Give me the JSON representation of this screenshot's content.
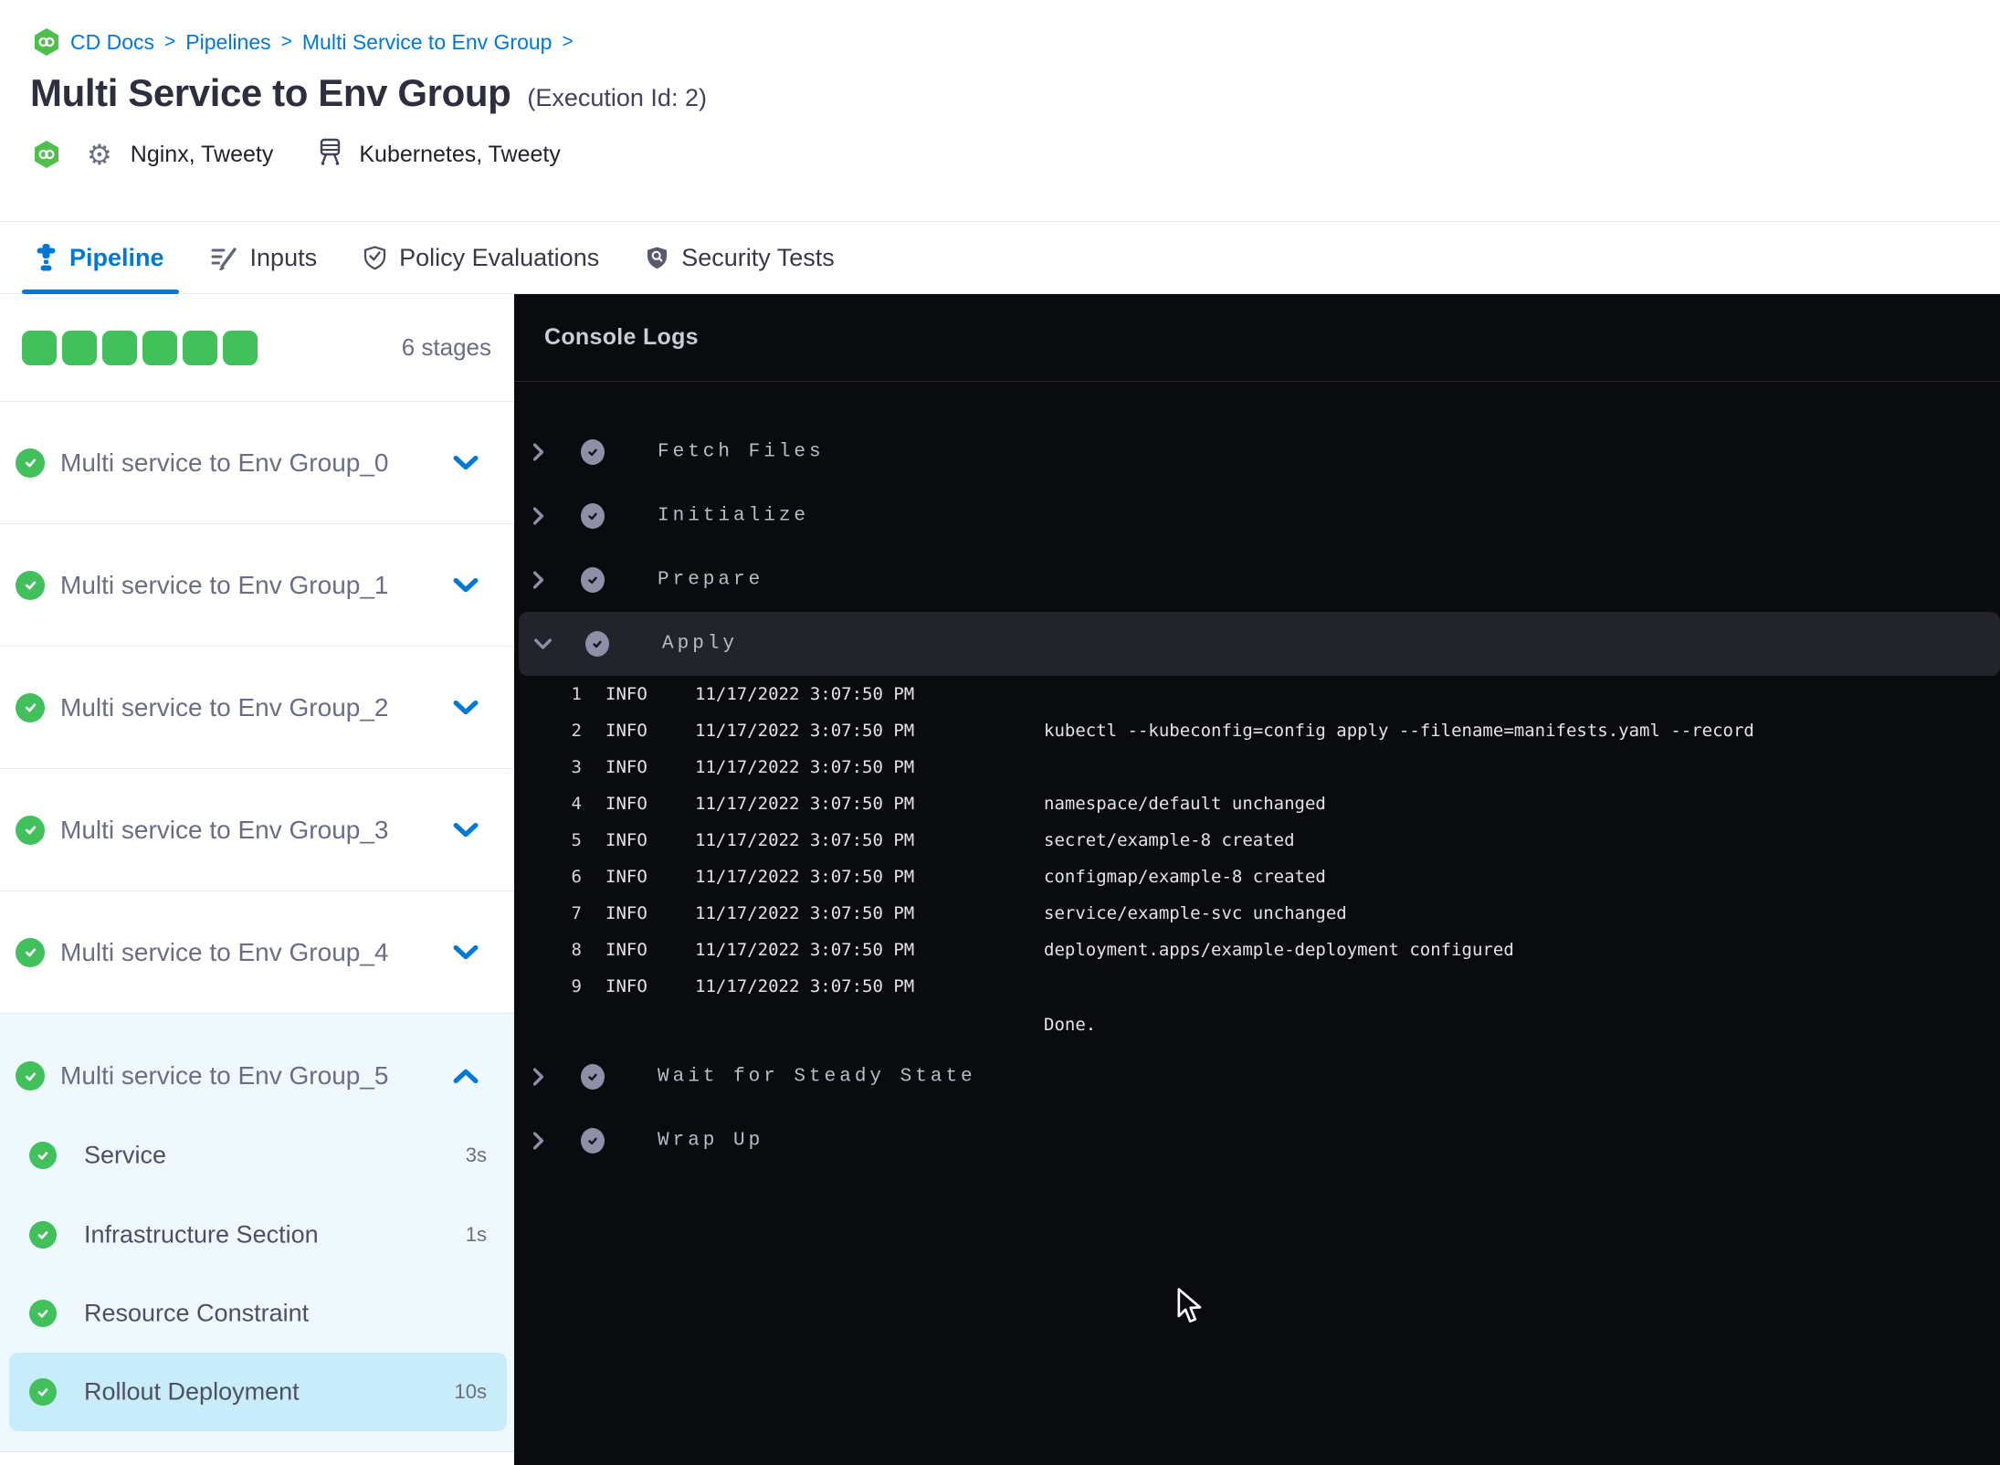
{
  "breadcrumb": {
    "separator": ">",
    "items": [
      "CD Docs",
      "Pipelines",
      "Multi Service to Env Group"
    ]
  },
  "header": {
    "title": "Multi Service to Env Group",
    "execution_id": "(Execution Id: 2)",
    "services_label": "Nginx, Tweety",
    "environments_label": "Kubernetes, Tweety"
  },
  "tabs": [
    {
      "label": "Pipeline",
      "active": true
    },
    {
      "label": "Inputs",
      "active": false
    },
    {
      "label": "Policy Evaluations",
      "active": false
    },
    {
      "label": "Security Tests",
      "active": false
    }
  ],
  "stages_panel": {
    "stage_count_label": "6 stages",
    "progress_squares": 6,
    "stages": [
      {
        "name": "Multi service to Env Group_0",
        "status": "success",
        "expanded": false
      },
      {
        "name": "Multi service to Env Group_1",
        "status": "success",
        "expanded": false
      },
      {
        "name": "Multi service to Env Group_2",
        "status": "success",
        "expanded": false
      },
      {
        "name": "Multi service to Env Group_3",
        "status": "success",
        "expanded": false
      },
      {
        "name": "Multi service to Env Group_4",
        "status": "success",
        "expanded": false
      },
      {
        "name": "Multi service to Env Group_5",
        "status": "success",
        "expanded": true,
        "steps": [
          {
            "name": "Service",
            "duration": "3s",
            "selected": false
          },
          {
            "name": "Infrastructure Section",
            "duration": "1s",
            "selected": false
          },
          {
            "name": "Resource Constraint",
            "duration": "",
            "selected": false
          },
          {
            "name": "Rollout Deployment",
            "duration": "10s",
            "selected": true
          }
        ]
      }
    ]
  },
  "console": {
    "title": "Console Logs",
    "steps": [
      {
        "name": "Fetch Files",
        "expanded": false
      },
      {
        "name": "Initialize",
        "expanded": false
      },
      {
        "name": "Prepare",
        "expanded": false
      },
      {
        "name": "Apply",
        "expanded": true
      },
      {
        "name": "Wait for Steady State",
        "expanded": false
      },
      {
        "name": "Wrap Up",
        "expanded": false
      }
    ],
    "apply_logs": {
      "lines": [
        {
          "num": "1",
          "level": "INFO",
          "time": "11/17/2022 3:07:50 PM",
          "message": ""
        },
        {
          "num": "2",
          "level": "INFO",
          "time": "11/17/2022 3:07:50 PM",
          "message": "kubectl --kubeconfig=config apply --filename=manifests.yaml --record"
        },
        {
          "num": "3",
          "level": "INFO",
          "time": "11/17/2022 3:07:50 PM",
          "message": ""
        },
        {
          "num": "4",
          "level": "INFO",
          "time": "11/17/2022 3:07:50 PM",
          "message": "namespace/default unchanged"
        },
        {
          "num": "5",
          "level": "INFO",
          "time": "11/17/2022 3:07:50 PM",
          "message": "secret/example-8 created"
        },
        {
          "num": "6",
          "level": "INFO",
          "time": "11/17/2022 3:07:50 PM",
          "message": "configmap/example-8 created"
        },
        {
          "num": "7",
          "level": "INFO",
          "time": "11/17/2022 3:07:50 PM",
          "message": "service/example-svc unchanged"
        },
        {
          "num": "8",
          "level": "INFO",
          "time": "11/17/2022 3:07:50 PM",
          "message": "deployment.apps/example-deployment configured"
        },
        {
          "num": "9",
          "level": "INFO",
          "time": "11/17/2022 3:07:50 PM",
          "message": ""
        }
      ],
      "footer": "Done."
    }
  },
  "colors": {
    "accent_blue": "#0278d5",
    "success_green": "#42c05c",
    "console_bg": "#0a0b0e",
    "console_row_highlight": "#22232b",
    "selected_step_bg": "#c9ecfb",
    "expanded_stage_bg": "#eff9fd"
  },
  "icons": [
    "link-hexagon-icon",
    "services-gear-icon",
    "environments-icon",
    "pipeline-icon",
    "inputs-icon",
    "policy-evaluations-icon",
    "security-tests-icon",
    "chevron-down-icon",
    "chevron-up-icon",
    "chevron-right-icon",
    "success-check-icon",
    "mouse-cursor"
  ]
}
